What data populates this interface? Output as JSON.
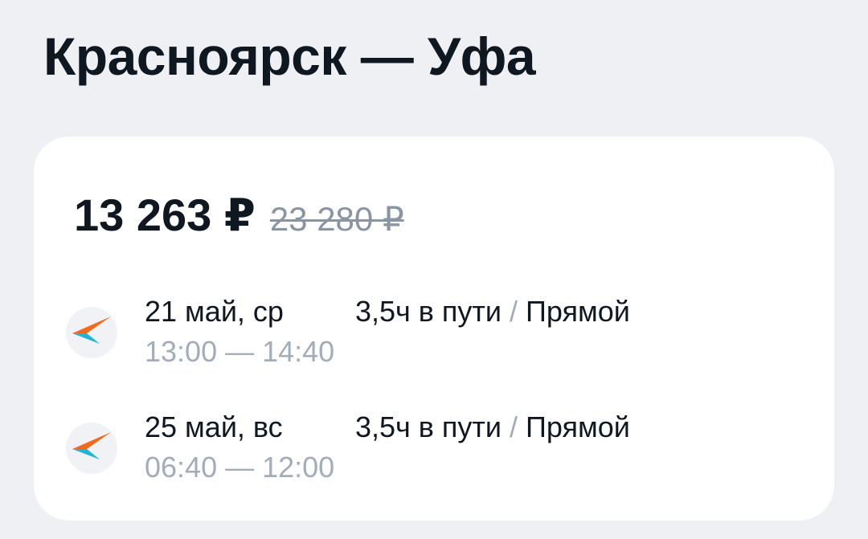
{
  "route": {
    "title": "Красноярск — Уфа"
  },
  "offer": {
    "price_current": "13 263 ₽",
    "price_old": "23 280 ₽"
  },
  "segments": [
    {
      "date": "21 май, ср",
      "time": "13:00 — 14:40",
      "duration": "3,5ч в пути",
      "separator": "/",
      "type": "Прямой",
      "airline_icon": "airline-logo-icon"
    },
    {
      "date": "25 май, вс",
      "time": "06:40 — 12:00",
      "duration": "3,5ч в пути",
      "separator": "/",
      "type": "Прямой",
      "airline_icon": "airline-logo-icon"
    }
  ],
  "colors": {
    "background": "#eef0f4",
    "card": "#ffffff",
    "text_primary": "#0f1720",
    "text_muted": "#a3adba",
    "logo_orange": "#f26a1b",
    "logo_cyan": "#1fb5d9"
  }
}
